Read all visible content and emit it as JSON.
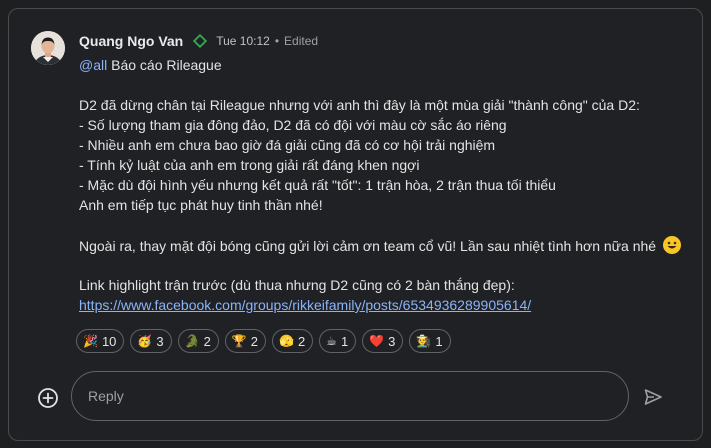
{
  "message": {
    "author": "Quang Ngo Van",
    "time": "Tue 10:12",
    "separator": "•",
    "edited": "Edited",
    "mention": "@all",
    "title": "Báo cáo Rileague",
    "lines": [
      "D2 đã dừng chân tại Rileague nhưng với anh thì đây là một mùa giải \"thành công\" của D2:",
      "- Số lượng tham gia đông đảo, D2 đã có đội với màu cờ sắc áo riêng",
      "- Nhiều anh em chưa bao giờ đá giải cũng đã có cơ hội trải nghiệm",
      "- Tính kỷ luật của anh em trong giải rất đáng khen ngợi",
      "- Mặc dù đội hình yếu nhưng kết quả rất \"tốt\": 1 trận hòa, 2 trận thua tối thiểu",
      "Anh em tiếp tục phát huy tinh thần nhé!"
    ],
    "thanks": "Ngoài ra, thay mặt đội bóng cũng gửi lời cảm ơn team cổ vũ! Lần sau nhiệt tình hơn nữa nhé",
    "link_intro": "Link highlight trận trước (dù thua nhưng D2 cũng có 2 bàn thắng đẹp):",
    "link": "https://www.facebook.com/groups/rikkeifamily/posts/6534936289905614/"
  },
  "reactions": [
    {
      "emoji": "🎉",
      "count": "10"
    },
    {
      "emoji": "🥳",
      "count": "3"
    },
    {
      "emoji": "🐊",
      "count": "2"
    },
    {
      "emoji": "🏆",
      "count": "2"
    },
    {
      "emoji": "🫣",
      "count": "2"
    },
    {
      "emoji": "☕",
      "count": "1"
    },
    {
      "emoji": "❤️",
      "count": "3"
    },
    {
      "emoji": "🧑‍🌾",
      "count": "1"
    }
  ],
  "reply": {
    "placeholder": "Reply"
  },
  "icons": {
    "status": "diamond-icon",
    "add": "add-circle-icon",
    "send": "send-icon",
    "smile": "smiley-icon"
  },
  "colors": {
    "background": "#202124",
    "border": "#4a4b4e",
    "link": "#8ab4f8",
    "status_green": "#34a853",
    "smiley_yellow": "#f9c623"
  }
}
